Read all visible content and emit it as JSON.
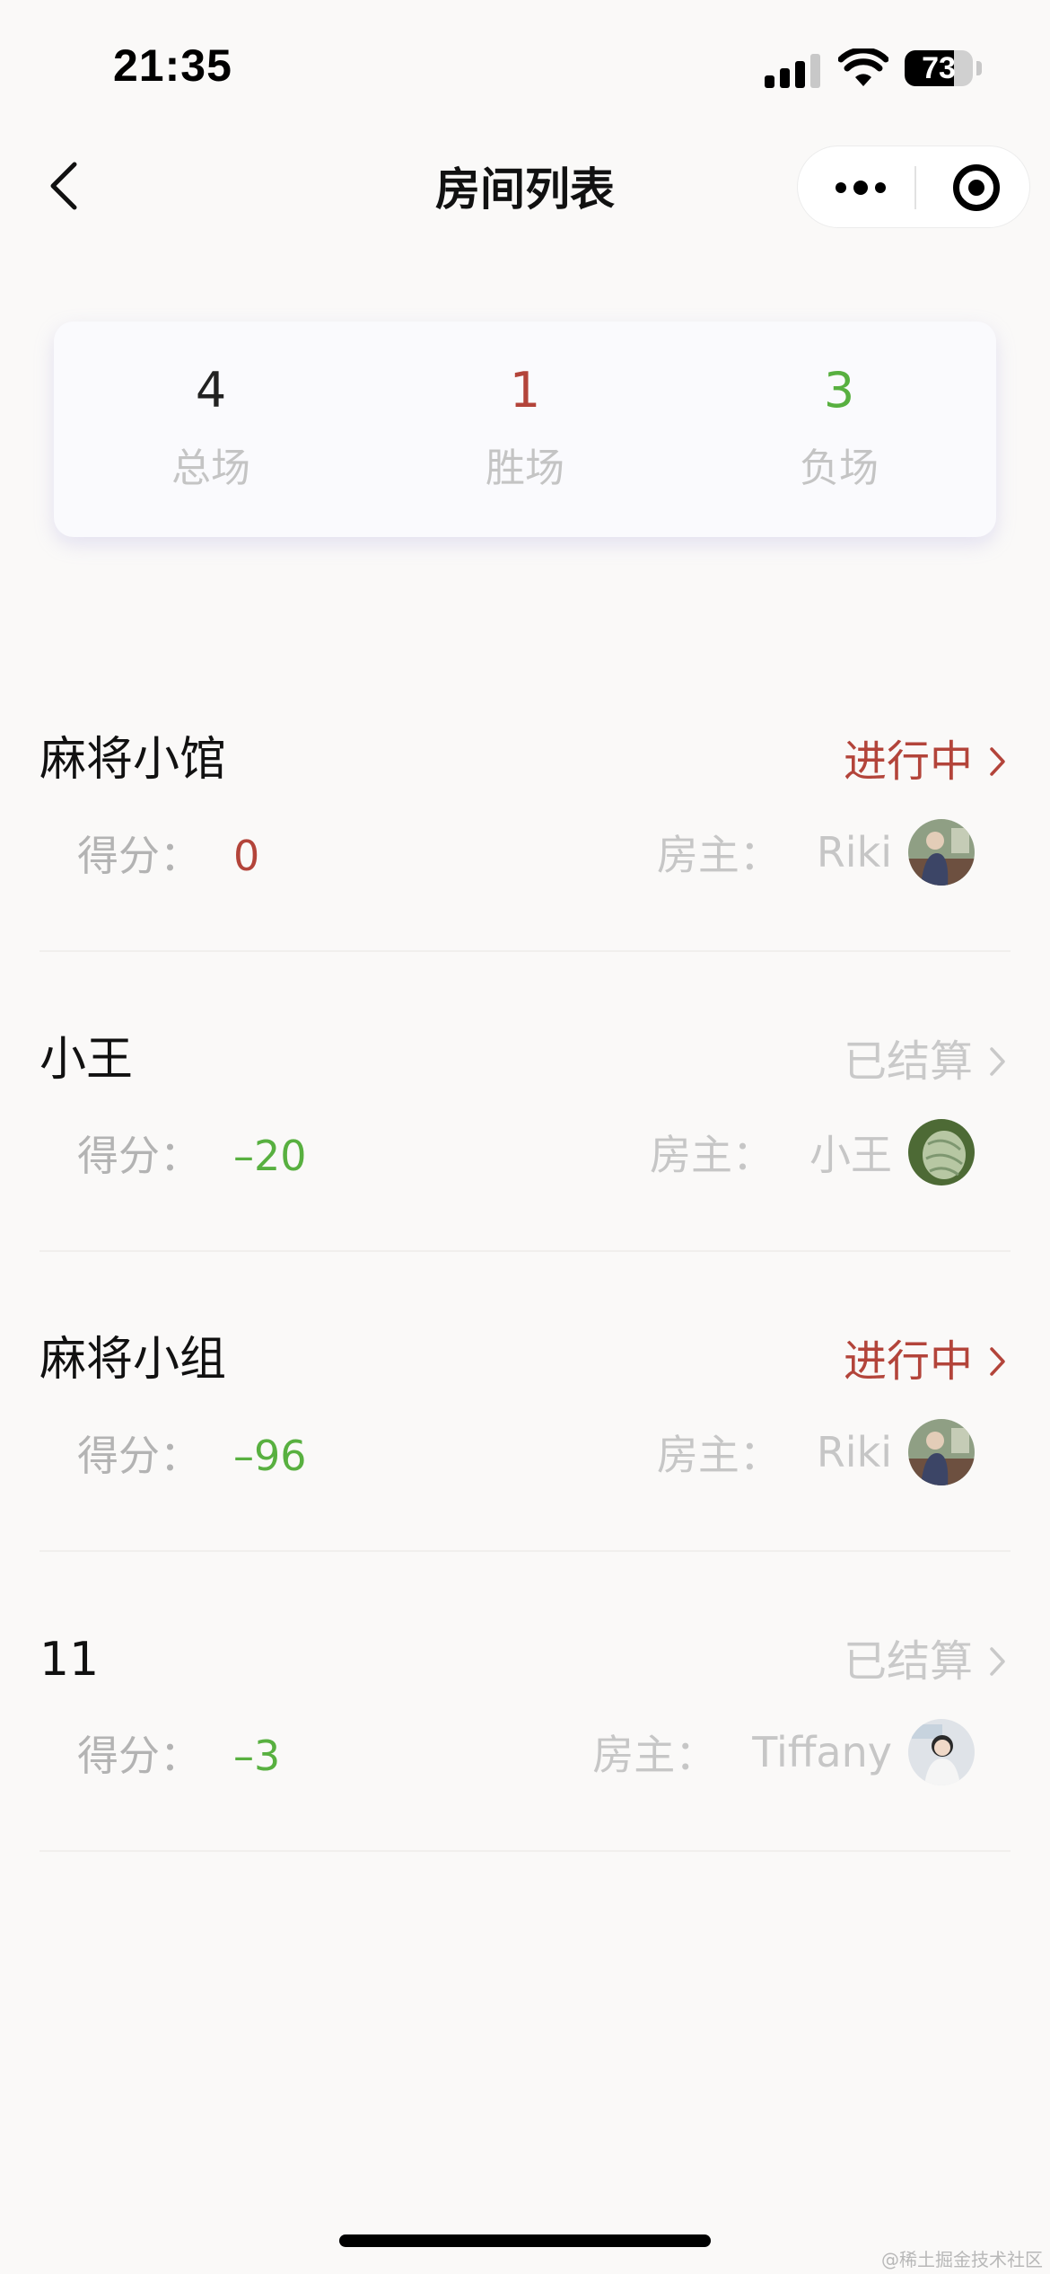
{
  "status_bar": {
    "time": "21:35",
    "battery": "73",
    "battery_level": 0.73
  },
  "nav": {
    "title": "房间列表",
    "back_icon": "chevron-left-icon",
    "more_icon": "more-dots-icon",
    "close_icon": "target-close-icon"
  },
  "summary": {
    "total": {
      "value": "4",
      "label": "总场",
      "color": "#222222"
    },
    "wins": {
      "value": "1",
      "label": "胜场",
      "color": "#b3443a"
    },
    "losses": {
      "value": "3",
      "label": "负场",
      "color": "#58b040"
    }
  },
  "score_label": "得分：",
  "host_label": "房主：",
  "rooms": [
    {
      "name": "麻将小馆",
      "status": "进行中",
      "status_type": "active",
      "score": "0",
      "score_color": "#b3443a",
      "host": "Riki",
      "avatar": "person-photo"
    },
    {
      "name": "小王",
      "status": "已结算",
      "status_type": "settled",
      "score": "–20",
      "score_color": "#58b040",
      "host": "小王",
      "avatar": "green-plant-photo"
    },
    {
      "name": "麻将小组",
      "status": "进行中",
      "status_type": "active",
      "score": "–96",
      "score_color": "#58b040",
      "host": "Riki",
      "avatar": "person-photo"
    },
    {
      "name": "11",
      "status": "已结算",
      "status_type": "settled",
      "score": "–3",
      "score_color": "#58b040",
      "host": "Tiffany",
      "avatar": "person-light-photo"
    }
  ],
  "watermark": "@稀土掘金技术社区"
}
